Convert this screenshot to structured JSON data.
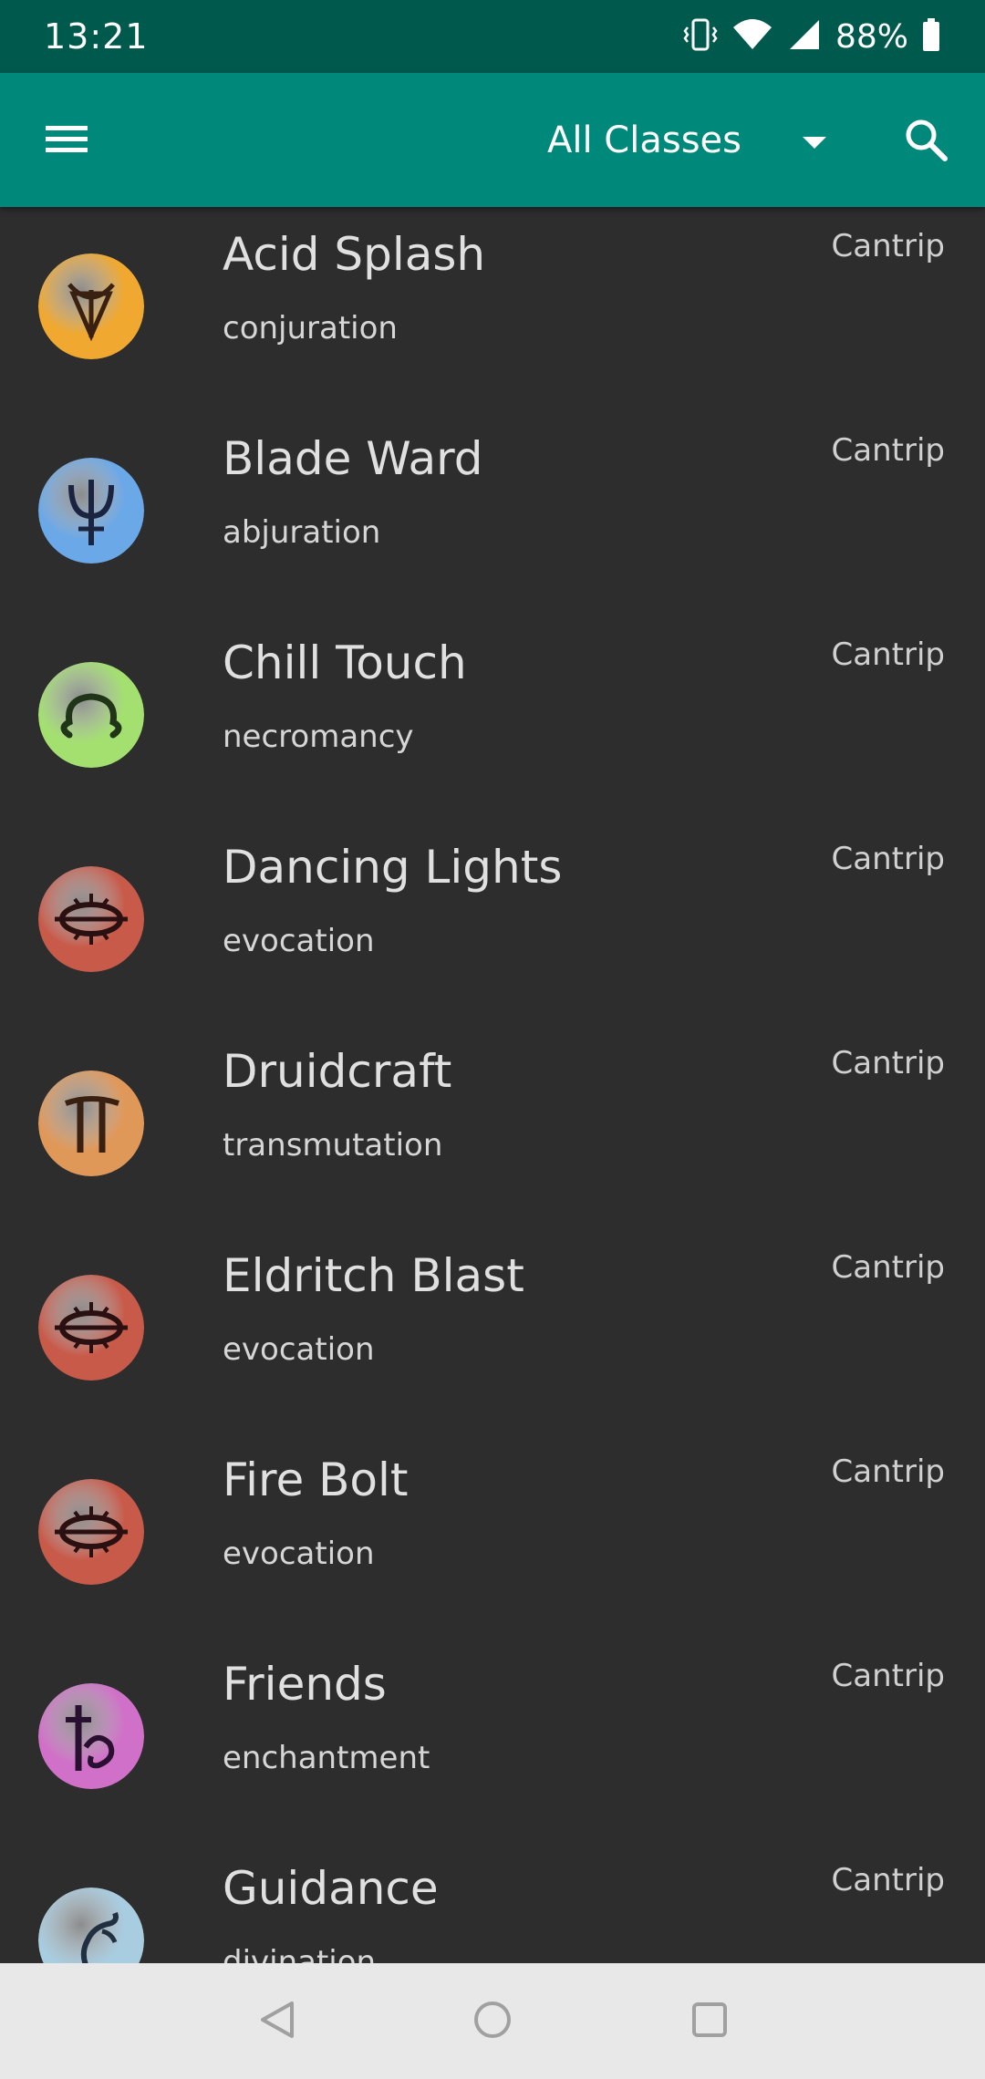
{
  "status_bar": {
    "time": "13:21",
    "battery_percent": "88%",
    "battery_level": 0.88
  },
  "app_bar": {
    "class_filter_label": "All Classes"
  },
  "spells": [
    {
      "name": "Acid Splash",
      "school": "conjuration",
      "level": "Cantrip",
      "icon": "conjuration-icon",
      "color": "#f0a830"
    },
    {
      "name": "Blade Ward",
      "school": "abjuration",
      "level": "Cantrip",
      "icon": "abjuration-icon",
      "color": "#6aa8e8"
    },
    {
      "name": "Chill Touch",
      "school": "necromancy",
      "level": "Cantrip",
      "icon": "necromancy-icon",
      "color": "#a4e070"
    },
    {
      "name": "Dancing Lights",
      "school": "evocation",
      "level": "Cantrip",
      "icon": "evocation-icon",
      "color": "#c85a4a"
    },
    {
      "name": "Druidcraft",
      "school": "transmutation",
      "level": "Cantrip",
      "icon": "transmutation-icon",
      "color": "#e09858"
    },
    {
      "name": "Eldritch Blast",
      "school": "evocation",
      "level": "Cantrip",
      "icon": "evocation-icon",
      "color": "#c85a4a"
    },
    {
      "name": "Fire Bolt",
      "school": "evocation",
      "level": "Cantrip",
      "icon": "evocation-icon",
      "color": "#c85a4a"
    },
    {
      "name": "Friends",
      "school": "enchantment",
      "level": "Cantrip",
      "icon": "enchantment-icon",
      "color": "#d070c8"
    },
    {
      "name": "Guidance",
      "school": "divination",
      "level": "Cantrip",
      "icon": "divination-icon",
      "color": "#a8cce0"
    }
  ],
  "colors": {
    "status_bar": "#00594d",
    "app_bar": "#00887a",
    "list_background": "#2d2d2d",
    "nav_bar": "#e8e8e8"
  }
}
